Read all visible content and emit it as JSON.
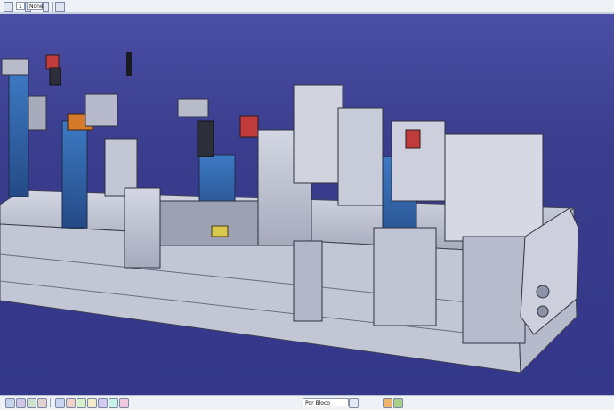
{
  "top_toolbar": {
    "layer_value": "1",
    "filter_value": "None"
  },
  "bottom_toolbar": {
    "style_value": "Por Bloco"
  },
  "colors": {
    "background": "#3a3d8c",
    "toolbar": "#eef1f6",
    "assembly_gray": "#c9cbd8",
    "assembly_dark": "#4b4d5a",
    "fixture_blue": "#3968a8",
    "accent_orange": "#d47a2a",
    "accent_yellow": "#d8c84b",
    "accent_red": "#c23b3b"
  },
  "icons": [
    "select-icon",
    "layer-icon",
    "filter-icon",
    "pan-icon",
    "rotate-icon",
    "zoom-in-icon",
    "zoom-out-icon",
    "fit-all-icon",
    "normal-view-icon",
    "iso-view-icon",
    "render-style-icon",
    "hide-show-icon",
    "measure-icon",
    "section-icon",
    "style-dropdown-icon",
    "material-icon",
    "analysis-icon"
  ]
}
